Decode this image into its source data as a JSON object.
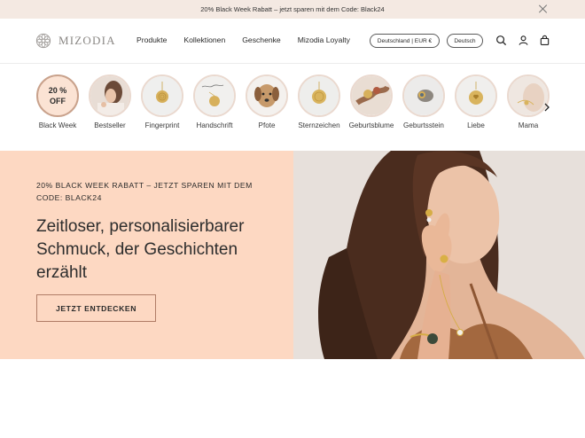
{
  "announcement": {
    "text": "20% Black Week Rabatt – jetzt sparen mit dem Code: Black24"
  },
  "header": {
    "brand": "MIZODIA",
    "nav": [
      "Produkte",
      "Kollektionen",
      "Geschenke",
      "Mizodia Loyalty"
    ],
    "country_selector": "Deutschland | EUR €",
    "language_selector": "Deutsch",
    "icons": [
      "search-icon",
      "account-icon",
      "cart-icon"
    ]
  },
  "categories": [
    {
      "label": "Black Week",
      "badge": "20 % OFF"
    },
    {
      "label": "Bestseller"
    },
    {
      "label": "Fingerprint"
    },
    {
      "label": "Handschrift"
    },
    {
      "label": "Pfote"
    },
    {
      "label": "Sternzeichen"
    },
    {
      "label": "Geburtsblume"
    },
    {
      "label": "Geburtsstein"
    },
    {
      "label": "Liebe"
    },
    {
      "label": "Mama"
    }
  ],
  "hero": {
    "eyebrow": "20% BLACK WEEK RABATT – JETZT SPAREN MIT DEM CODE: BLACK24",
    "title": "Zeitloser, personalisierbarer Schmuck, der Geschichten erzählt",
    "cta": "JETZT ENTDECKEN"
  },
  "colors": {
    "announcement_bg": "#f4e9e2",
    "hero_panel": "#fdd8c2",
    "button_border": "#b07c66"
  }
}
